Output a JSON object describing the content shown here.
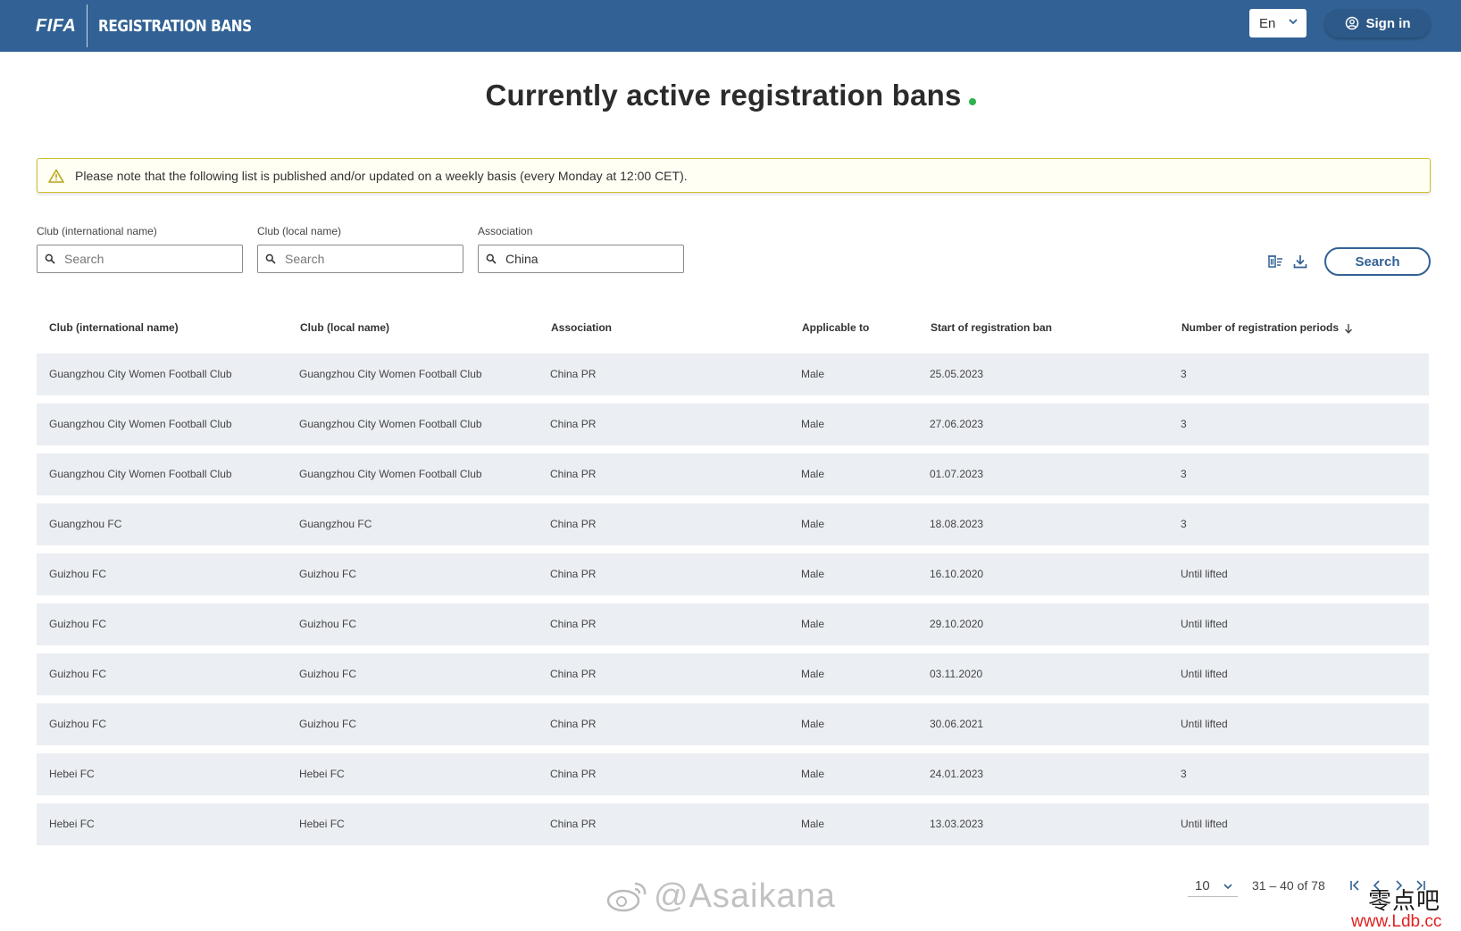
{
  "header": {
    "brand": "FIFA",
    "product": "REGISTRATION BANS",
    "language": "En",
    "sign_in": "Sign in"
  },
  "title": "Currently active registration bans",
  "notice": "Please note that the following list is published and/or updated on a weekly basis (every Monday at 12:00 CET).",
  "filters": {
    "club_international": {
      "label": "Club (international name)",
      "placeholder": "Search",
      "value": ""
    },
    "club_local": {
      "label": "Club (local name)",
      "placeholder": "Search",
      "value": ""
    },
    "association": {
      "label": "Association",
      "placeholder": "Search",
      "value": "China"
    },
    "search_button": "Search"
  },
  "table": {
    "headers": [
      "Club (international name)",
      "Club (local name)",
      "Association",
      "Applicable to",
      "Start of registration ban",
      "Number of registration periods"
    ],
    "rows": [
      [
        "Guangzhou City Women Football Club",
        "Guangzhou City Women Football Club",
        "China PR",
        "Male",
        "25.05.2023",
        "3"
      ],
      [
        "Guangzhou City Women Football Club",
        "Guangzhou City Women Football Club",
        "China PR",
        "Male",
        "27.06.2023",
        "3"
      ],
      [
        "Guangzhou City Women Football Club",
        "Guangzhou City Women Football Club",
        "China PR",
        "Male",
        "01.07.2023",
        "3"
      ],
      [
        "Guangzhou FC",
        "Guangzhou FC",
        "China PR",
        "Male",
        "18.08.2023",
        "3"
      ],
      [
        "Guizhou FC",
        "Guizhou FC",
        "China PR",
        "Male",
        "16.10.2020",
        "Until lifted"
      ],
      [
        "Guizhou FC",
        "Guizhou FC",
        "China PR",
        "Male",
        "29.10.2020",
        "Until lifted"
      ],
      [
        "Guizhou FC",
        "Guizhou FC",
        "China PR",
        "Male",
        "03.11.2020",
        "Until lifted"
      ],
      [
        "Guizhou FC",
        "Guizhou FC",
        "China PR",
        "Male",
        "30.06.2021",
        "Until lifted"
      ],
      [
        "Hebei FC",
        "Hebei FC",
        "China PR",
        "Male",
        "24.01.2023",
        "3"
      ],
      [
        "Hebei FC",
        "Hebei FC",
        "China PR",
        "Male",
        "13.03.2023",
        "Until lifted"
      ]
    ]
  },
  "pagination": {
    "page_size": "10",
    "range": "31 – 40 of 78"
  },
  "watermark": {
    "handle": "@Asaikana",
    "site_cn": "零点吧",
    "site_url": "www.Ldb.cc"
  },
  "colors": {
    "header_bg": "#326295",
    "accent": "#326295",
    "status_dot": "#2fb24a",
    "notice_border": "#cdbf2a",
    "row_bg": "#ebeef3"
  }
}
